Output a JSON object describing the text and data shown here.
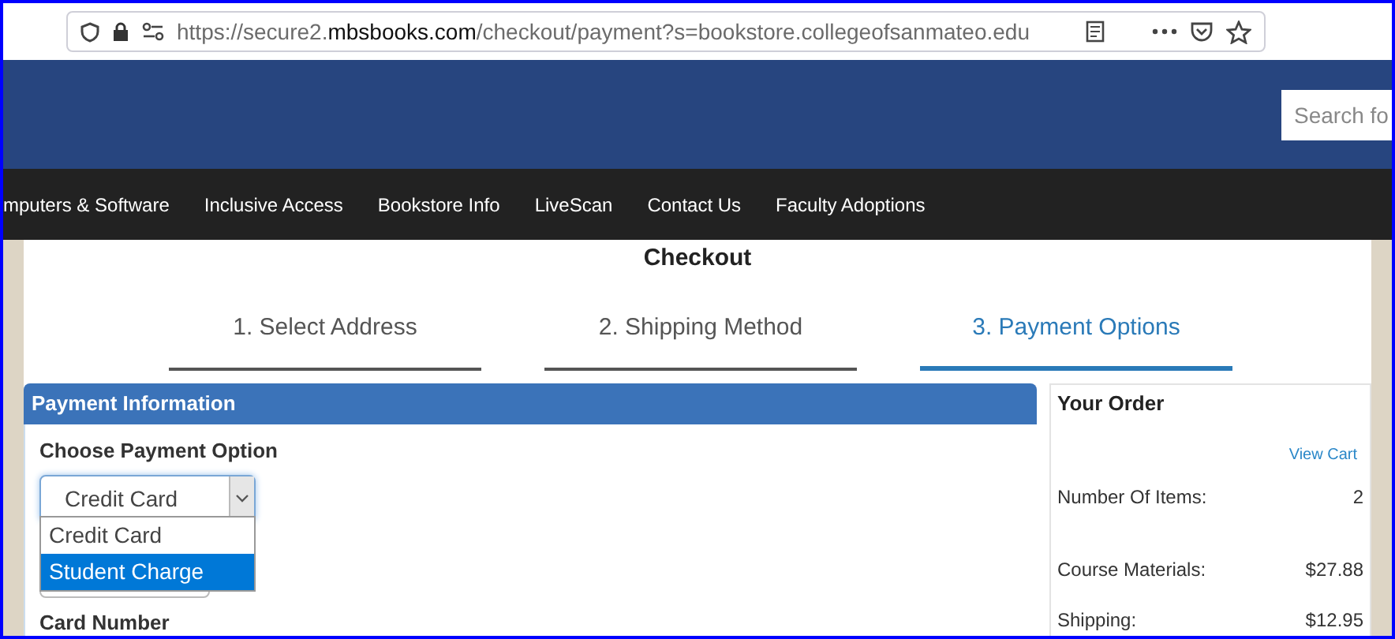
{
  "browser": {
    "url_prefix": "https://secure2.",
    "url_domain": "mbsbooks.com",
    "url_path": "/checkout/payment?s=bookstore.collegeofsanmateo.edu"
  },
  "header": {
    "search": {
      "placeholder": "Search fo"
    }
  },
  "nav": [
    "mputers & Software",
    "Inclusive Access",
    "Bookstore Info",
    "LiveScan",
    "Contact Us",
    "Faculty Adoptions"
  ],
  "page_title": "Checkout",
  "steps": [
    {
      "label": "1. Select Address",
      "selected": false
    },
    {
      "label": "2. Shipping Method",
      "selected": false
    },
    {
      "label": "3. Payment Options",
      "selected": true
    }
  ],
  "payment": {
    "title": "Payment Information",
    "option_label": "Choose Payment Option",
    "select_value": "Credit Card",
    "options": [
      {
        "label": "Credit Card",
        "selected": false
      },
      {
        "label": "Student Charge",
        "selected": true
      }
    ],
    "card_number_label": "Card Number"
  },
  "order": {
    "title": "Your Order",
    "view_cart": "View Cart",
    "rows": [
      {
        "label": "Number Of Items:",
        "value": "2"
      },
      {
        "label": "Course Materials:",
        "value": "$27.88"
      },
      {
        "label": "Shipping:",
        "value": "$12.95"
      }
    ]
  }
}
